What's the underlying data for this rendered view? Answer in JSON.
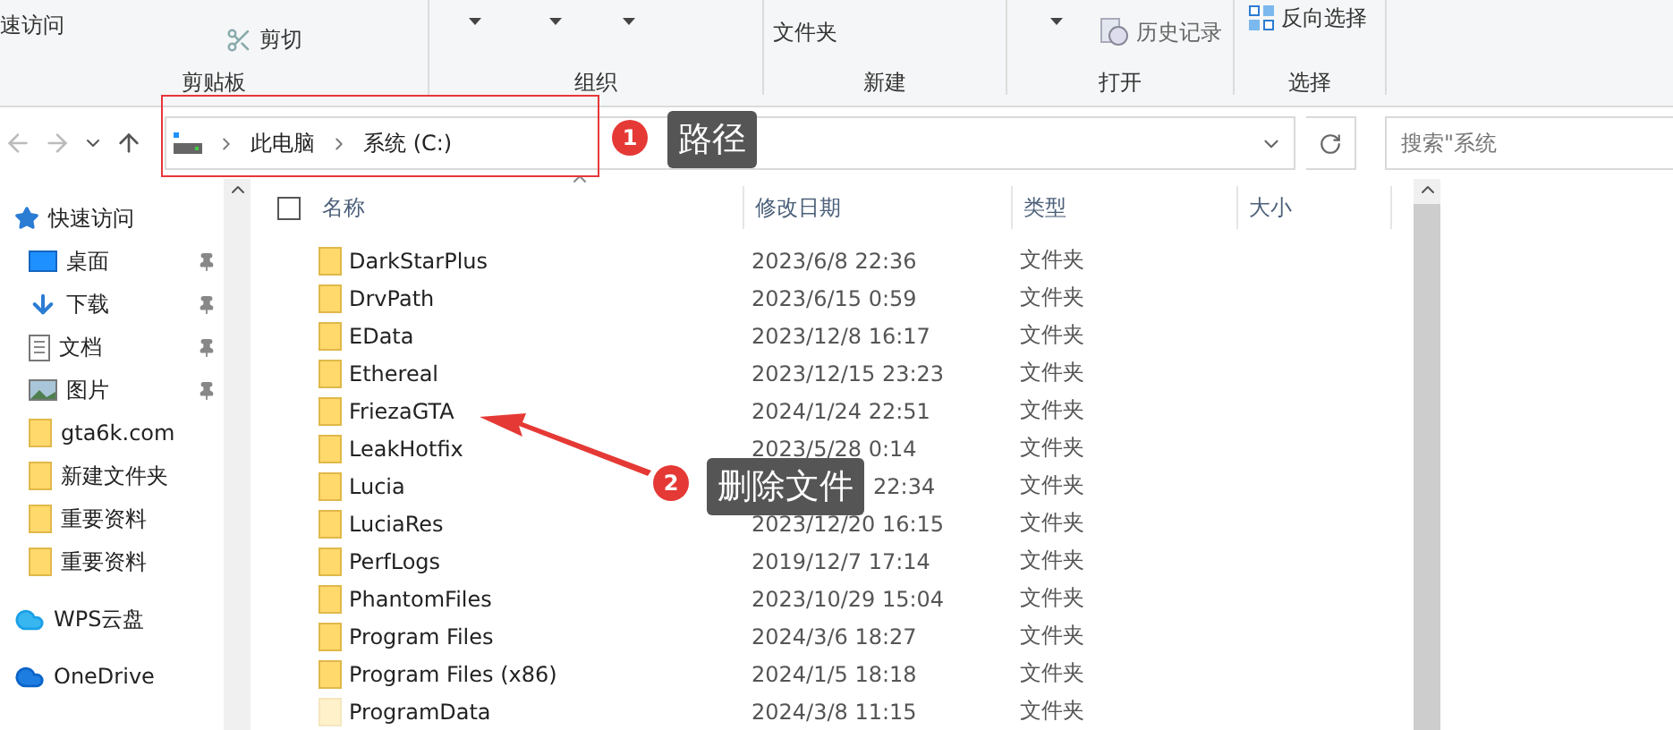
{
  "ribbon": {
    "groups": [
      {
        "label": "剪贴板",
        "items": [
          {
            "kind": "text",
            "text": "速访问"
          },
          {
            "kind": "cut",
            "text": "剪切"
          }
        ]
      },
      {
        "label": "组织",
        "items": [
          {
            "kind": "caret"
          },
          {
            "kind": "caret"
          },
          {
            "kind": "caret"
          }
        ]
      },
      {
        "label": "新建",
        "items": [
          {
            "kind": "text",
            "text": "文件夹"
          }
        ]
      },
      {
        "label": "打开",
        "items": [
          {
            "kind": "caret"
          },
          {
            "kind": "history",
            "text": "历史记录"
          }
        ]
      },
      {
        "label": "选择",
        "items": [
          {
            "kind": "invert",
            "text": "反向选择"
          }
        ]
      }
    ]
  },
  "address": {
    "crumbs": [
      "此电脑",
      "系统 (C:)"
    ],
    "search_placeholder": "搜索\"系统"
  },
  "sidebar": {
    "items": [
      {
        "kind": "star",
        "label": "快速访问",
        "pinned": false
      },
      {
        "kind": "desktop",
        "label": "桌面",
        "pinned": true
      },
      {
        "kind": "download",
        "label": "下载",
        "pinned": true
      },
      {
        "kind": "document",
        "label": "文档",
        "pinned": true
      },
      {
        "kind": "picture",
        "label": "图片",
        "pinned": true
      },
      {
        "kind": "folder",
        "label": "gta6k.com",
        "pinned": false
      },
      {
        "kind": "folder",
        "label": "新建文件夹",
        "pinned": false
      },
      {
        "kind": "folder",
        "label": "重要资料",
        "pinned": false
      },
      {
        "kind": "folder",
        "label": "重要资料",
        "pinned": false
      },
      {
        "kind": "wps",
        "label": "WPS云盘",
        "pinned": false
      },
      {
        "kind": "onedrive",
        "label": "OneDrive",
        "pinned": false
      }
    ]
  },
  "table": {
    "select_all": {
      "checked": false
    },
    "columns": [
      "名称",
      "修改日期",
      "类型",
      "大小"
    ],
    "rows": [
      {
        "name": "DarkStarPlus",
        "date": "2023/6/8 22:36",
        "type": "文件夹",
        "hidden": false,
        "covered": false
      },
      {
        "name": "DrvPath",
        "date": "2023/6/15 0:59",
        "type": "文件夹",
        "hidden": false,
        "covered": false
      },
      {
        "name": "EData",
        "date": "2023/12/8 16:17",
        "type": "文件夹",
        "hidden": false,
        "covered": false
      },
      {
        "name": "Ethereal",
        "date": "2023/12/15 23:23",
        "type": "文件夹",
        "hidden": false,
        "covered": false
      },
      {
        "name": "FriezaGTA",
        "date": "2024/1/24 22:51",
        "type": "文件夹",
        "hidden": false,
        "covered": false
      },
      {
        "name": "LeakHotfix",
        "date": "2023/5/28 0:14",
        "type": "文件夹",
        "hidden": false,
        "covered": false
      },
      {
        "name": "Lucia",
        "date": "22:34",
        "type": "文件夹",
        "hidden": false,
        "covered": true
      },
      {
        "name": "LuciaRes",
        "date": "2023/12/20 16:15",
        "type": "文件夹",
        "hidden": false,
        "covered": false
      },
      {
        "name": "PerfLogs",
        "date": "2019/12/7 17:14",
        "type": "文件夹",
        "hidden": false,
        "covered": false
      },
      {
        "name": "PhantomFiles",
        "date": "2023/10/29 15:04",
        "type": "文件夹",
        "hidden": false,
        "covered": false
      },
      {
        "name": "Program Files",
        "date": "2024/3/6 18:27",
        "type": "文件夹",
        "hidden": false,
        "covered": false
      },
      {
        "name": "Program Files (x86)",
        "date": "2024/1/5 18:18",
        "type": "文件夹",
        "hidden": false,
        "covered": false
      },
      {
        "name": "ProgramData",
        "date": "2024/3/8 11:15",
        "type": "文件夹",
        "hidden": true,
        "covered": false
      }
    ]
  },
  "annotations": [
    {
      "number": "1",
      "label": "路径"
    },
    {
      "number": "2",
      "label": "删除文件"
    }
  ]
}
